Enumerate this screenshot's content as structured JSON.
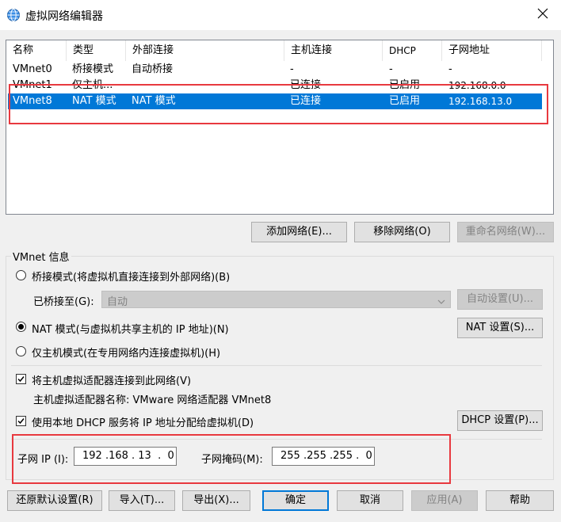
{
  "window": {
    "title": "虚拟网络编辑器",
    "icon": "globe-network-icon",
    "close_icon": "close-icon"
  },
  "list": {
    "columns": [
      "名称",
      "类型",
      "外部连接",
      "主机连接",
      "DHCP",
      "子网地址"
    ],
    "rows": [
      {
        "name": "VMnet0",
        "type": "桥接模式",
        "external": "自动桥接",
        "host": "-",
        "dhcp": "-",
        "subnet": "-"
      },
      {
        "name": "VMnet1",
        "type": "仅主机...",
        "external": "-",
        "host": "已连接",
        "dhcp": "已启用",
        "subnet": "192.168.0.0"
      },
      {
        "name": "VMnet8",
        "type": "NAT 模式",
        "external": "NAT 模式",
        "host": "已连接",
        "dhcp": "已启用",
        "subnet": "192.168.13.0"
      }
    ],
    "selected_row": "VMnet8"
  },
  "list_buttons": {
    "add": "添加网络(E)...",
    "remove": "移除网络(O)",
    "rename": "重命名网络(W)..."
  },
  "info": {
    "group_label": "VMnet 信息",
    "radio_bridge": "桥接模式(将虚拟机直接连接到外部网络)(B)",
    "bridged_to_label": "已桥接至(G):",
    "bridged_to_value": "自动",
    "auto_settings": "自动设置(U)...",
    "radio_nat": "NAT 模式(与虚拟机共享主机的 IP 地址)(N)",
    "nat_settings": "NAT 设置(S)...",
    "radio_hostonly": "仅主机模式(在专用网络内连接虚拟机)(H)",
    "selected_mode": "nat",
    "connect_adapter": "将主机虚拟适配器连接到此网络(V)",
    "adapter_name": "主机虚拟适配器名称: VMware 网络适配器 VMnet8",
    "use_dhcp": "使用本地 DHCP 服务将 IP 地址分配给虚拟机(D)",
    "dhcp_settings": "DHCP 设置(P)...",
    "subnet_ip_label": "子网 IP (I):",
    "subnet_ip_value": "192 .168 . 13  .  0",
    "subnet_mask_label": "子网掩码(M):",
    "subnet_mask_value": "255 .255 .255 .  0"
  },
  "footer": {
    "restore": "还原默认设置(R)",
    "import": "导入(T)...",
    "export": "导出(X)...",
    "ok": "确定",
    "cancel": "取消",
    "apply": "应用(A)",
    "help": "帮助"
  },
  "colors": {
    "selection": "#0078d7",
    "highlight_box": "#e8393f",
    "background": "#f0f0f0"
  }
}
